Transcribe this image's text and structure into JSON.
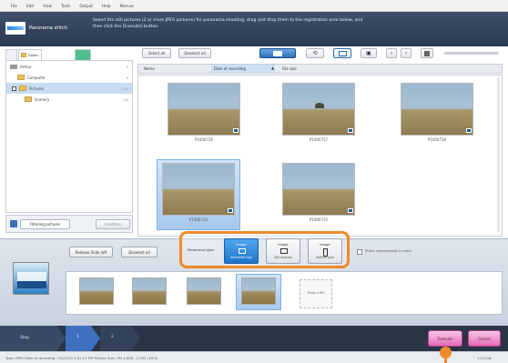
{
  "menu": [
    "File",
    "Edit",
    "View",
    "Tools",
    "Output",
    "Help",
    "Manual"
  ],
  "header": {
    "title": "Panorama stitch",
    "instruction": "Select the still pictures (2 or more JPEG pictures) for panorama shooting, drag and drop them to the registration area below, and then click the [Execute] button."
  },
  "left_panel": {
    "tab_label": "Folder",
    "tree": [
      {
        "label": "Arthur",
        "count": "1"
      },
      {
        "label": "Computer",
        "count": "9"
      },
      {
        "label": "Pictures",
        "count": "114",
        "selected": true
      },
      {
        "label": "Scenery",
        "count": "24"
      }
    ],
    "filter_label": "Filtering pictures",
    "filter_button": "Condition"
  },
  "toolbar": {
    "select_all": "Select all",
    "deselect_all": "Deselect all",
    "sort_headers": [
      "Name",
      "Date of recording",
      "File size"
    ]
  },
  "thumbnails": [
    {
      "name": "P1000726",
      "selected": false
    },
    {
      "name": "P1000727",
      "selected": false
    },
    {
      "name": "P1000728",
      "selected": false
    },
    {
      "name": "P1000733",
      "selected": true
    },
    {
      "name": "P1000735",
      "selected": false
    }
  ],
  "bottom": {
    "release_btn": "Release Slide left",
    "deselect_btn": "Deselect all",
    "panorama_type_label": "Panorama type",
    "types": [
      {
        "title": "Image",
        "sub": "Horizontal type",
        "selected": true
      },
      {
        "title": "Image",
        "sub": "360 degrees",
        "selected": false
      },
      {
        "title": "Image",
        "sub": "Vertical type",
        "selected": false
      }
    ],
    "auto_checkbox": "Stitch automatically in order",
    "drop_text": "Drop a file"
  },
  "steps": {
    "step_label": "Step",
    "step1": "1",
    "step2": "2",
    "execute": "Execute",
    "cancel": "Cancel"
  },
  "status": {
    "left": "Type: JPEG  Date of recording: 7/1/2010 3:01:27 PM  Picture Size: 3M 4,608 : 2,592 (16:9)",
    "right": "1/14 file"
  },
  "colors": {
    "accent": "#f08a2a",
    "header_bg": "#3f4f6a",
    "selected_blue": "#1e75c9",
    "execute_pink": "#e46ab8"
  }
}
